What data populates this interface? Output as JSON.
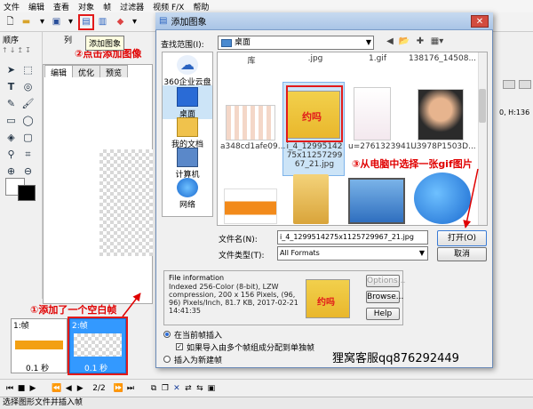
{
  "menubar": [
    "文件",
    "编辑",
    "查看",
    "对象",
    "帧",
    "过滤器",
    "视频 F/X",
    "帮助"
  ],
  "left_panel": {
    "seq_label": "顺序",
    "col_label": "列"
  },
  "tabs": [
    "编辑",
    "优化",
    "预览"
  ],
  "tooltip": "添加图象",
  "right_readout": "0, H:136",
  "annotations": {
    "step1": "①添加了一个空白帧",
    "step2": "②点击添加图像",
    "step3": "③从电脑中选择一张gif图片"
  },
  "frames": [
    {
      "title": "1:帧",
      "time": "0.1 秒"
    },
    {
      "title": "2:帧",
      "time": "0.1 秒"
    }
  ],
  "playbar": {
    "page": "2/2"
  },
  "statusbar": "选择图形文件并插入帧",
  "dialog": {
    "title": "添加图象",
    "lookin_label": "查找范围(I):",
    "lookin_value": "桌面",
    "places": [
      "360企业云盘",
      "桌面",
      "我的文档",
      "计算机",
      "网络"
    ],
    "files_row1_captions": [
      "库",
      ".jpg",
      "1.gif",
      "138176_14508..."
    ],
    "files_row2_captions": [
      "a348cd1afe09...",
      "i_4_1299514275x1125729967_21.jpg",
      "u=2761323941...",
      "U3978P1503D..."
    ],
    "filename_label": "文件名(N):",
    "filename_value": "i_4_1299514275x1125729967_21.jpg",
    "filetype_label": "文件类型(T):",
    "filetype_value": "All Formats",
    "open_label": "打开(O)",
    "cancel_label": "取消",
    "finfo_title": "File information",
    "finfo_text": "Indexed 256-Color (8-bit), LZW compression, 200 x 156 Pixels, (96, 96) Pixels/Inch, 81.7 KB, 2017-02-21 14:41:35",
    "finfo_thumb_text": "约吗",
    "thumb_text": "约吗",
    "options_label": "Options...",
    "browse_label": "Browse...",
    "help_label": "Help",
    "radio_insert_current": "在当前帧插入",
    "check_multi_frame": "如果导入由多个帧组成分配到单独帧",
    "radio_new_frame": "插入为新建帧"
  },
  "watermark": "狸窝客服qq876292449"
}
